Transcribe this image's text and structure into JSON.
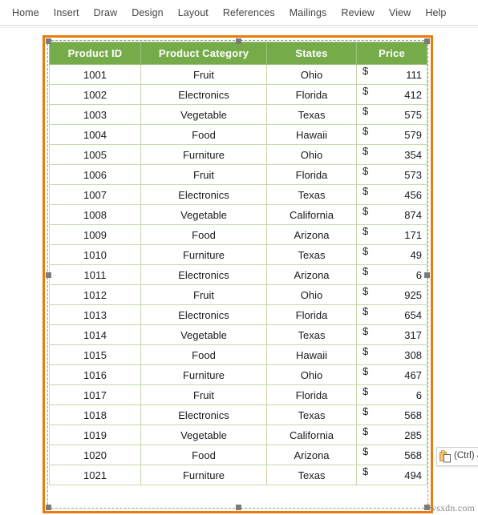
{
  "ribbon": {
    "tabs": [
      {
        "label": "Home"
      },
      {
        "label": "Insert"
      },
      {
        "label": "Draw"
      },
      {
        "label": "Design"
      },
      {
        "label": "Layout"
      },
      {
        "label": "References"
      },
      {
        "label": "Mailings"
      },
      {
        "label": "Review"
      },
      {
        "label": "View"
      },
      {
        "label": "Help"
      }
    ]
  },
  "table": {
    "headers": [
      "Product ID",
      "Product Category",
      "States",
      "Price"
    ],
    "currency_symbol": "$",
    "header_bg": "#76AB4A",
    "header_text_color": "#FFFFFF",
    "grid_color": "#C3D9A8",
    "selection_border_color": "#E87D0D",
    "rows": [
      {
        "product_id": "1001",
        "category": "Fruit",
        "state": "Ohio",
        "price": "111"
      },
      {
        "product_id": "1002",
        "category": "Electronics",
        "state": "Florida",
        "price": "412"
      },
      {
        "product_id": "1003",
        "category": "Vegetable",
        "state": "Texas",
        "price": "575"
      },
      {
        "product_id": "1004",
        "category": "Food",
        "state": "Hawaii",
        "price": "579"
      },
      {
        "product_id": "1005",
        "category": "Furniture",
        "state": "Ohio",
        "price": "354"
      },
      {
        "product_id": "1006",
        "category": "Fruit",
        "state": "Florida",
        "price": "573"
      },
      {
        "product_id": "1007",
        "category": "Electronics",
        "state": "Texas",
        "price": "456"
      },
      {
        "product_id": "1008",
        "category": "Vegetable",
        "state": "California",
        "price": "874"
      },
      {
        "product_id": "1009",
        "category": "Food",
        "state": "Arizona",
        "price": "171"
      },
      {
        "product_id": "1010",
        "category": "Furniture",
        "state": "Texas",
        "price": "49"
      },
      {
        "product_id": "1011",
        "category": "Electronics",
        "state": "Arizona",
        "price": "6"
      },
      {
        "product_id": "1012",
        "category": "Fruit",
        "state": "Ohio",
        "price": "925"
      },
      {
        "product_id": "1013",
        "category": "Electronics",
        "state": "Florida",
        "price": "654"
      },
      {
        "product_id": "1014",
        "category": "Vegetable",
        "state": "Texas",
        "price": "317"
      },
      {
        "product_id": "1015",
        "category": "Food",
        "state": "Hawaii",
        "price": "308"
      },
      {
        "product_id": "1016",
        "category": "Furniture",
        "state": "Ohio",
        "price": "467"
      },
      {
        "product_id": "1017",
        "category": "Fruit",
        "state": "Florida",
        "price": "6"
      },
      {
        "product_id": "1018",
        "category": "Electronics",
        "state": "Texas",
        "price": "568"
      },
      {
        "product_id": "1019",
        "category": "Vegetable",
        "state": "California",
        "price": "285"
      },
      {
        "product_id": "1020",
        "category": "Food",
        "state": "Arizona",
        "price": "568"
      },
      {
        "product_id": "1021",
        "category": "Furniture",
        "state": "Texas",
        "price": "494"
      }
    ]
  },
  "paste_options": {
    "icon": "clipboard-icon",
    "label": "(Ctrl)",
    "caret": "▾"
  },
  "watermark": {
    "text": "wsxdn.com"
  }
}
